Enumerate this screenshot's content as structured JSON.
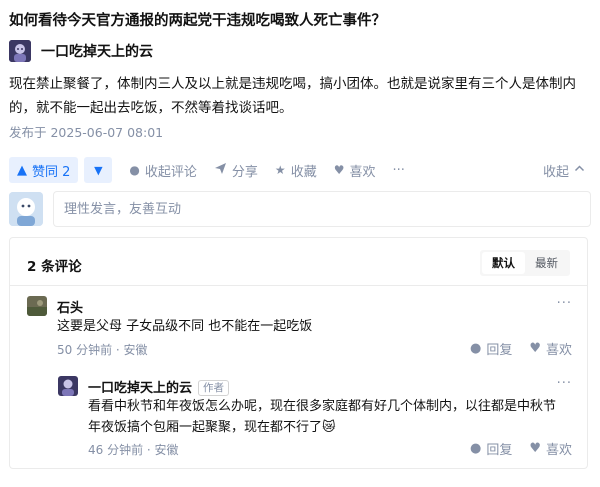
{
  "question": {
    "title": "如何看待今天官方通报的两起党干违规吃喝致人死亡事件？"
  },
  "answer": {
    "author": "一口吃掉天上的云",
    "content": "现在禁止聚餐了，体制内三人及以上就是违规吃喝，搞小团体。也就是说家里有三个人是体制内的，就不能一起出去吃饭，不然等着找谈话吧。",
    "published": "发布于 2025-06-07 08:01"
  },
  "actions": {
    "upvote_label": "赞同 2",
    "downvote_icon": "triangle-down-icon",
    "collapse_comments": "收起评论",
    "share": "分享",
    "favorite": "收藏",
    "like": "喜欢",
    "more": "···",
    "collapse": "收起"
  },
  "composer": {
    "placeholder": "理性发言，友善互动"
  },
  "comments": {
    "count_label": "2 条评论",
    "sort_default": "默认",
    "sort_latest": "最新",
    "items": [
      {
        "author": "石头",
        "text": "这要是父母 子女品级不同 也不能在一起吃饭",
        "meta": "50 分钟前 · 安徽",
        "reply": "回复",
        "like": "喜欢",
        "more": "···"
      },
      {
        "author": "一口吃掉天上的云",
        "tag": "作者",
        "text_line1": "看看中秋节和年夜饭怎么办呢，现在很多家庭都有好几个体制内，以往都是中秋节",
        "text_line2": "年夜饭搞个包厢一起聚聚，现在都不行了😿",
        "meta": "46 分钟前 · 安徽",
        "reply": "回复",
        "like": "喜欢",
        "more": "···"
      }
    ]
  },
  "colors": {
    "accent": "#1772f6",
    "accent_bg": "#e8f0fe",
    "muted": "#8590a6",
    "border": "#ebebeb"
  }
}
